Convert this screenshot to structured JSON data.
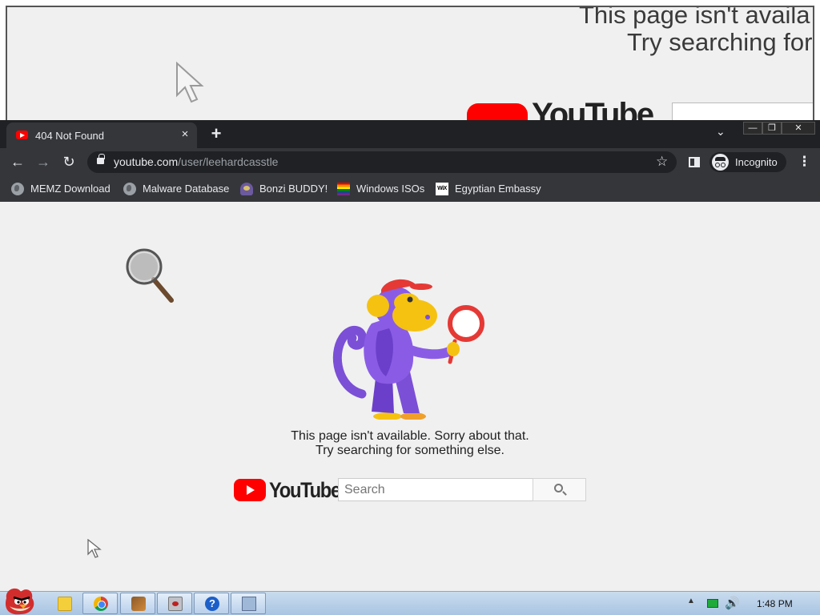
{
  "ghost_window": {
    "line1": "This page isn't availa",
    "line2": "Try searching for",
    "logo_text": "YouTube"
  },
  "browser": {
    "tab": {
      "title": "404 Not Found",
      "close_label": "×"
    },
    "new_tab_label": "+",
    "window_controls": {
      "minimize": "—",
      "maximize": "❐",
      "close": "✕"
    },
    "nav": {
      "back": "←",
      "forward": "→",
      "reload": "↻"
    },
    "omnibox": {
      "host": "youtube.com",
      "path": "/user/leehardcasstle"
    },
    "star": "☆",
    "incognito_label": "Incognito",
    "menu": "⋮",
    "bookmarks": [
      {
        "label": "MEMZ Download",
        "icon": "globe-icon"
      },
      {
        "label": "Malware Database",
        "icon": "globe-icon"
      },
      {
        "label": "Bonzi BUDDY!",
        "icon": "bonzi-icon"
      },
      {
        "label": "Windows ISOs",
        "icon": "rainbow-flag-icon"
      },
      {
        "label": "Egyptian Embassy",
        "icon": "wix-icon"
      }
    ]
  },
  "page": {
    "message_line1": "This page isn't available. Sorry about that.",
    "message_line2": "Try searching for something else.",
    "logo_text": "YouTube",
    "search_placeholder": "Search",
    "brand_color": "#ff0000"
  },
  "taskbar": {
    "help_glyph": "?",
    "clock": "1:48 PM"
  }
}
